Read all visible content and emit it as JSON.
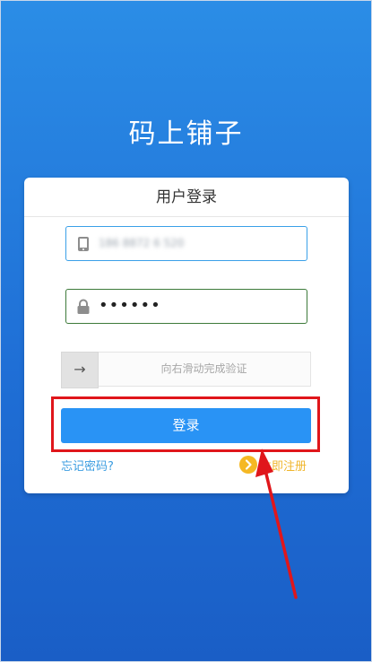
{
  "app": {
    "title": "码上铺子"
  },
  "login_card": {
    "header": "用户登录",
    "phone_field": {
      "value": "186 8872 6 520",
      "icon": "phone-icon"
    },
    "password_field": {
      "value": "••••••",
      "icon": "lock-icon"
    },
    "slider": {
      "handle_glyph": "→",
      "text": "向右滑动完成验证"
    },
    "login_button": "登录",
    "forgot_link": "忘记密码?",
    "register_link": "立即注册"
  },
  "colors": {
    "background_top": "#2b8de6",
    "background_bottom": "#1a5ec6",
    "button_blue": "#2993f5",
    "link_blue": "#3c9de0",
    "register_orange": "#f0b62c",
    "annotation_red": "#e0161b"
  }
}
